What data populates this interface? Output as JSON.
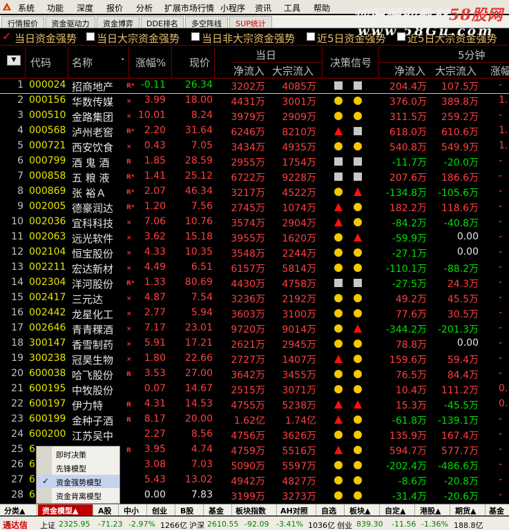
{
  "menu": [
    "系统",
    "功能",
    "深度",
    "报价",
    "分析",
    "扩展市场行情",
    "小程序",
    "资讯",
    "工具",
    "帮助"
  ],
  "watermark": {
    "line1_a": "炒股輔助教材",
    "line1_b": "58股网",
    "line2": "www.58Gu.com"
  },
  "tabs": [
    "行情报价",
    "资金驱动力",
    "资金博弈",
    "DDE排名",
    "多空阵线",
    "SUP统计"
  ],
  "filters": [
    "当日资金强势",
    "当日大宗资金强势",
    "当日非大宗资金强势",
    "近5日资金强势",
    "近5日大宗资金强势"
  ],
  "header": {
    "code": "代码",
    "name": "名称",
    "chg": "涨幅%",
    "price": "现价",
    "today": "当日",
    "net": "净流入",
    "big": "大宗流入",
    "signal": "决策信号",
    "five": "5分钟",
    "net5": "净流入",
    "big5": "大宗流入",
    "chg5": "涨幅"
  },
  "rows": [
    {
      "n": "1",
      "code": "000024",
      "name": "招商地产",
      "mk": "R*",
      "chg": "-0.11",
      "price": "26.34",
      "net": "3202万",
      "big": "4085万",
      "s1": "sq",
      "s2": "sq",
      "n5": "204.4万",
      "b5": "107.5万",
      "cc": "grn",
      "pc": "grn",
      "n5c": "red",
      "b5c": "red"
    },
    {
      "n": "2",
      "code": "000156",
      "name": "华数传媒",
      "mk": "×",
      "chg": "3.99",
      "price": "18.00",
      "net": "4431万",
      "big": "3001万",
      "s1": "dot",
      "s2": "dot",
      "n5": "376.0万",
      "b5": "389.8万",
      "cc": "red",
      "pc": "red",
      "n5c": "red",
      "b5c": "red"
    },
    {
      "n": "3",
      "code": "000510",
      "name": "金路集团",
      "mk": "×",
      "chg": "10.01",
      "price": "8.24",
      "net": "3979万",
      "big": "2909万",
      "s1": "dot",
      "s2": "dot",
      "n5": "311.5万",
      "b5": "259.2万",
      "cc": "red",
      "pc": "red",
      "n5c": "red",
      "b5c": "red"
    },
    {
      "n": "4",
      "code": "000568",
      "name": "泸州老窖",
      "mk": "R*",
      "chg": "2.20",
      "price": "31.64",
      "net": "6246万",
      "big": "8210万",
      "s1": "tri",
      "s2": "sq",
      "n5": "618.0万",
      "b5": "610.6万",
      "cc": "red",
      "pc": "red",
      "n5c": "red",
      "b5c": "red"
    },
    {
      "n": "5",
      "code": "000721",
      "name": "西安饮食",
      "mk": "×",
      "chg": "0.43",
      "price": "7.05",
      "net": "3434万",
      "big": "4935万",
      "s1": "dot",
      "s2": "dot",
      "n5": "540.8万",
      "b5": "549.9万",
      "cc": "red",
      "pc": "red",
      "n5c": "red",
      "b5c": "red"
    },
    {
      "n": "6",
      "code": "000799",
      "name": "酒 鬼 酒",
      "mk": "R",
      "chg": "1.85",
      "price": "28.59",
      "net": "2955万",
      "big": "1754万",
      "s1": "sq",
      "s2": "sq",
      "n5": "-11.7万",
      "b5": "-20.0万",
      "cc": "red",
      "pc": "red",
      "n5c": "grn",
      "b5c": "grn"
    },
    {
      "n": "7",
      "code": "000858",
      "name": "五 粮 液",
      "mk": "R*",
      "chg": "1.41",
      "price": "25.12",
      "net": "6722万",
      "big": "9228万",
      "s1": "sq",
      "s2": "sq",
      "n5": "207.6万",
      "b5": "186.6万",
      "cc": "red",
      "pc": "red",
      "n5c": "red",
      "b5c": "red"
    },
    {
      "n": "8",
      "code": "000869",
      "name": "张 裕Ａ",
      "mk": "R*",
      "chg": "2.07",
      "price": "46.34",
      "net": "3217万",
      "big": "4522万",
      "s1": "dot",
      "s2": "tri",
      "n5": "-134.8万",
      "b5": "-105.6万",
      "cc": "red",
      "pc": "red",
      "n5c": "grn",
      "b5c": "grn"
    },
    {
      "n": "9",
      "code": "002005",
      "name": "德豪润达",
      "mk": "R*",
      "chg": "1.20",
      "price": "7.56",
      "net": "2745万",
      "big": "1074万",
      "s1": "tri",
      "s2": "dot",
      "n5": "182.2万",
      "b5": "118.6万",
      "cc": "red",
      "pc": "red",
      "n5c": "red",
      "b5c": "red"
    },
    {
      "n": "10",
      "code": "002036",
      "name": "宜科科技",
      "mk": "×",
      "chg": "7.06",
      "price": "10.76",
      "net": "3574万",
      "big": "2904万",
      "s1": "tri",
      "s2": "dot",
      "n5": "-84.2万",
      "b5": "-40.8万",
      "cc": "red",
      "pc": "red",
      "n5c": "grn",
      "b5c": "grn"
    },
    {
      "n": "11",
      "code": "002063",
      "name": "远光软件",
      "mk": "×",
      "chg": "3.62",
      "price": "15.18",
      "net": "3955万",
      "big": "1620万",
      "s1": "dot",
      "s2": "tri",
      "n5": "-59.9万",
      "b5": "0.00",
      "cc": "red",
      "pc": "red",
      "n5c": "grn",
      "b5c": "wht"
    },
    {
      "n": "12",
      "code": "002104",
      "name": "恒宝股份",
      "mk": "×",
      "chg": "4.33",
      "price": "10.35",
      "net": "3548万",
      "big": "2244万",
      "s1": "dot",
      "s2": "dot",
      "n5": "-27.1万",
      "b5": "0.00",
      "cc": "red",
      "pc": "red",
      "n5c": "grn",
      "b5c": "wht"
    },
    {
      "n": "13",
      "code": "002211",
      "name": "宏达新材",
      "mk": "×",
      "chg": "4.49",
      "price": "6.51",
      "net": "6157万",
      "big": "5814万",
      "s1": "dot",
      "s2": "dot",
      "n5": "-110.1万",
      "b5": "-88.2万",
      "cc": "red",
      "pc": "red",
      "n5c": "grn",
      "b5c": "grn"
    },
    {
      "n": "14",
      "code": "002304",
      "name": "洋河股份",
      "mk": "R*",
      "chg": "1.33",
      "price": "80.69",
      "net": "4430万",
      "big": "4758万",
      "s1": "sq",
      "s2": "sq",
      "n5": "-27.5万",
      "b5": "24.3万",
      "cc": "red",
      "pc": "red",
      "n5c": "grn",
      "b5c": "red"
    },
    {
      "n": "15",
      "code": "002417",
      "name": "三元达",
      "mk": "×",
      "chg": "4.87",
      "price": "7.54",
      "net": "3236万",
      "big": "2192万",
      "s1": "dot",
      "s2": "dot",
      "n5": "49.2万",
      "b5": "45.5万",
      "cc": "red",
      "pc": "red",
      "n5c": "red",
      "b5c": "red"
    },
    {
      "n": "16",
      "code": "002442",
      "name": "龙星化工",
      "mk": "×",
      "chg": "2.77",
      "price": "5.94",
      "net": "3603万",
      "big": "3100万",
      "s1": "dot",
      "s2": "dot",
      "n5": "77.6万",
      "b5": "30.5万",
      "cc": "red",
      "pc": "red",
      "n5c": "red",
      "b5c": "red"
    },
    {
      "n": "17",
      "code": "002646",
      "name": "青青稞酒",
      "mk": "×",
      "chg": "7.17",
      "price": "23.01",
      "net": "9720万",
      "big": "9014万",
      "s1": "dot",
      "s2": "tri",
      "n5": "-344.2万",
      "b5": "-201.3万",
      "cc": "red",
      "pc": "red",
      "n5c": "grn",
      "b5c": "grn"
    },
    {
      "n": "18",
      "code": "300147",
      "name": "香雪制药",
      "mk": "×",
      "chg": "5.91",
      "price": "17.21",
      "net": "2621万",
      "big": "2945万",
      "s1": "dot",
      "s2": "dot",
      "n5": "78.8万",
      "b5": "0.00",
      "cc": "red",
      "pc": "red",
      "n5c": "red",
      "b5c": "wht"
    },
    {
      "n": "19",
      "code": "300238",
      "name": "冠昊生物",
      "mk": "×",
      "chg": "1.80",
      "price": "22.66",
      "net": "2727万",
      "big": "1407万",
      "s1": "tri",
      "s2": "dot",
      "n5": "159.6万",
      "b5": "59.4万",
      "cc": "red",
      "pc": "red",
      "n5c": "red",
      "b5c": "red"
    },
    {
      "n": "20",
      "code": "600038",
      "name": "哈飞股份",
      "mk": "R",
      "chg": "3.53",
      "price": "27.00",
      "net": "3642万",
      "big": "3455万",
      "s1": "dot",
      "s2": "dot",
      "n5": "76.5万",
      "b5": "84.4万",
      "cc": "red",
      "pc": "red",
      "n5c": "red",
      "b5c": "red"
    },
    {
      "n": "21",
      "code": "600195",
      "name": "中牧股份",
      "mk": "",
      "chg": "0.07",
      "price": "14.67",
      "net": "2515万",
      "big": "3071万",
      "s1": "dot",
      "s2": "dot",
      "n5": "10.4万",
      "b5": "111.2万",
      "cc": "red",
      "pc": "red",
      "n5c": "red",
      "b5c": "red"
    },
    {
      "n": "22",
      "code": "600197",
      "name": "伊力特",
      "mk": "R",
      "chg": "4.31",
      "price": "14.53",
      "net": "4755万",
      "big": "5238万",
      "s1": "tri",
      "s2": "tri",
      "n5": "15.3万",
      "b5": "-45.5万",
      "cc": "red",
      "pc": "red",
      "n5c": "red",
      "b5c": "grn"
    },
    {
      "n": "23",
      "code": "600199",
      "name": "金种子酒",
      "mk": "R",
      "chg": "8.17",
      "price": "20.00",
      "net": "1.62亿",
      "big": "1.74亿",
      "s1": "tri",
      "s2": "dot",
      "n5": "-61.8万",
      "b5": "-139.1万",
      "cc": "red",
      "pc": "red",
      "n5c": "grn",
      "b5c": "grn"
    },
    {
      "n": "24",
      "code": "600200",
      "name": "江苏吴中",
      "mk": "",
      "chg": "2.27",
      "price": "8.56",
      "net": "4756万",
      "big": "3626万",
      "s1": "dot",
      "s2": "dot",
      "n5": "135.9万",
      "b5": "167.4万",
      "cc": "red",
      "pc": "red",
      "n5c": "red",
      "b5c": "red"
    },
    {
      "n": "25",
      "code": "6",
      "name": "",
      "mk": "R",
      "chg": "3.95",
      "price": "4.74",
      "net": "4759万",
      "big": "5516万",
      "s1": "tri",
      "s2": "dot",
      "n5": "594.7万",
      "b5": "577.7万",
      "cc": "red",
      "pc": "red",
      "n5c": "red",
      "b5c": "red"
    },
    {
      "n": "26",
      "code": "6",
      "name": "",
      "mk": "",
      "chg": "3.08",
      "price": "7.03",
      "net": "5090万",
      "big": "5597万",
      "s1": "dot",
      "s2": "dot",
      "n5": "-202.4万",
      "b5": "-486.6万",
      "cc": "red",
      "pc": "red",
      "n5c": "grn",
      "b5c": "grn"
    },
    {
      "n": "27",
      "code": "6",
      "name": "",
      "mk": "",
      "chg": "5.43",
      "price": "13.02",
      "net": "4942万",
      "big": "4827万",
      "s1": "dot",
      "s2": "dot",
      "n5": "-8.6万",
      "b5": "-20.8万",
      "cc": "red",
      "pc": "red",
      "n5c": "grn",
      "b5c": "grn"
    },
    {
      "n": "28",
      "code": "6",
      "name": "",
      "mk": "",
      "chg": "0.00",
      "price": "7.83",
      "net": "3199万",
      "big": "3273万",
      "s1": "dot",
      "s2": "dot",
      "n5": "-31.4万",
      "b5": "-20.6万",
      "cc": "wht",
      "pc": "wht",
      "n5c": "grn",
      "b5c": "grn"
    }
  ],
  "z5": [
    "-",
    "1.",
    "-",
    "1.",
    "1.",
    "-",
    "-",
    "-",
    "-",
    "-",
    "-",
    "-",
    "-",
    "-",
    "-",
    "-",
    "-",
    "-",
    "-",
    "-",
    "0.",
    "0.",
    "-",
    "-",
    "-",
    "-",
    "-",
    "-"
  ],
  "popup": {
    "items": [
      "即时决策",
      "先锋模型",
      "资金强势模型",
      "资金背离模型"
    ],
    "selected": 2
  },
  "bottom_tabs": [
    "分类▲",
    "资金模型▲",
    "A股",
    "中小",
    "创业",
    "B股",
    "基金",
    "板块指数",
    "AH对照",
    "自选",
    "板块▲",
    "自定▲",
    "港股▲",
    "期货▲",
    "基金"
  ],
  "status": {
    "brand": "通达信",
    "sh_label": "上证",
    "sh_val": "2325.95",
    "sh_chg": "-71.23",
    "sh_pct": "-2.97%",
    "sh_amt": "1266亿",
    "hs_label": "沪深",
    "hs_val": "2610.55",
    "hs_chg": "-92.09",
    "hs_pct": "-3.41%",
    "hs_amt": "1036亿",
    "cy_label": "创业",
    "cy_val": "839.30",
    "cy_chg": "-11.56",
    "cy_pct": "-1.36%",
    "cy_amt": "188.8亿"
  }
}
